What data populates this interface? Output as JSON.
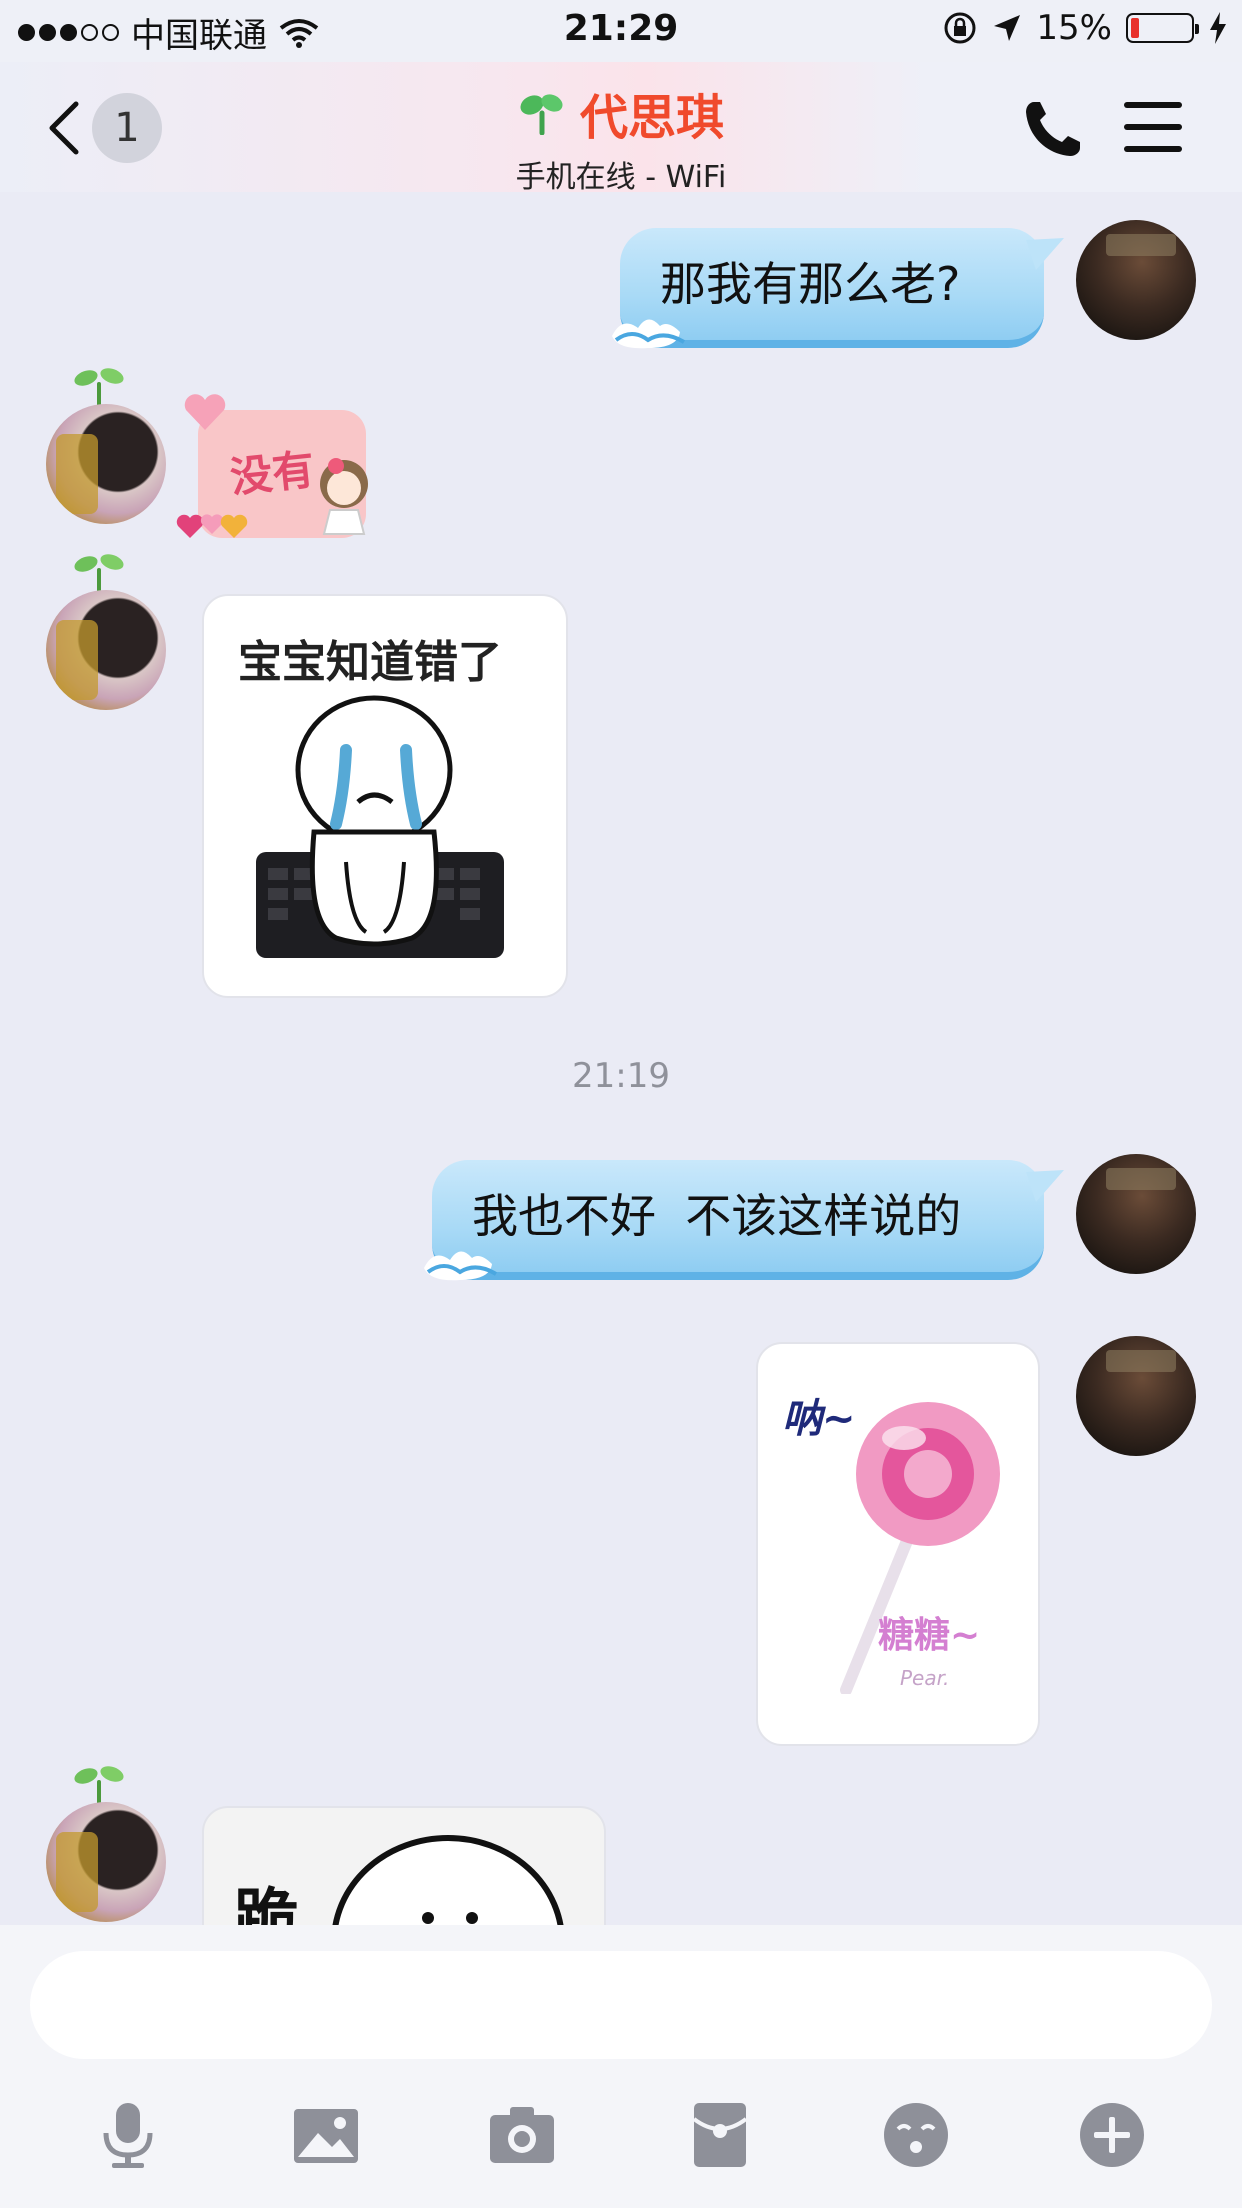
{
  "status_bar": {
    "carrier": "中国联通",
    "time": "21:29",
    "battery_percent": "15%",
    "signal_bars_full": 3,
    "signal_bars_total": 5,
    "battery_level": 0.15
  },
  "header": {
    "back_badge": "1",
    "contact_name": "代思琪",
    "status": "手机在线 - WiFi",
    "accent_color": "#f04a2c"
  },
  "messages": [
    {
      "from": "me",
      "type": "text",
      "text": "那我有那么老?"
    },
    {
      "from": "her",
      "type": "sticker",
      "sticker_text": "没有"
    },
    {
      "from": "her",
      "type": "sticker",
      "sticker_text": "宝宝知道错了"
    },
    {
      "from": "system",
      "type": "timestamp",
      "text": "21:19"
    },
    {
      "from": "me",
      "type": "text",
      "text": "我也不好  不该这样说的"
    },
    {
      "from": "me",
      "type": "sticker",
      "sticker_text_1": "呐~",
      "sticker_text_2": "糖糖~",
      "sticker_signature": "Pear."
    },
    {
      "from": "her",
      "type": "sticker",
      "sticker_text": "跪"
    }
  ],
  "input": {
    "placeholder": "",
    "value": ""
  },
  "toolbar": {
    "icons": [
      "microphone-icon",
      "image-icon",
      "camera-icon",
      "red-packet-icon",
      "emoji-icon",
      "plus-icon"
    ],
    "icon_color": "#8e9099"
  }
}
